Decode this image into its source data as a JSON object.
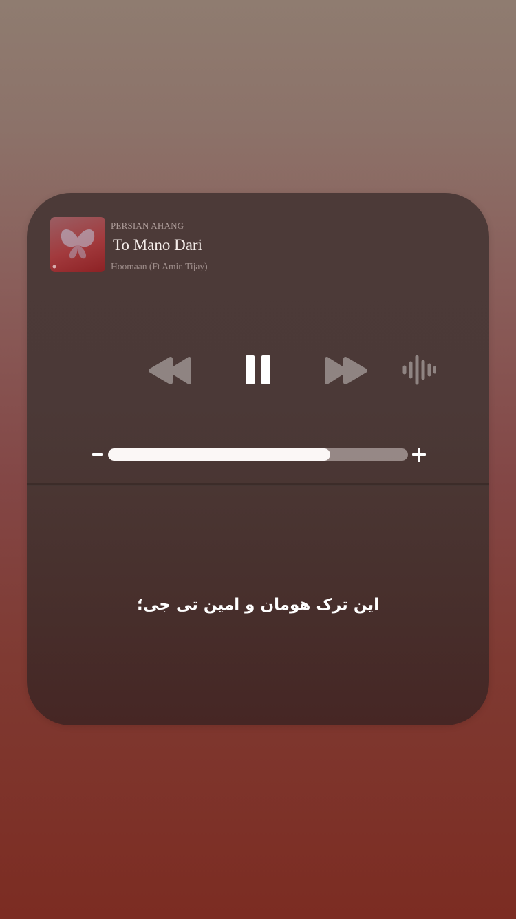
{
  "player": {
    "app_name": "PERSIAN AHANG",
    "title": "To Mano Dari",
    "artist": "Hoomaan (Ft Amin Tijay)",
    "controls": {
      "rewind_icon": "rewind-icon",
      "pause_icon": "pause-icon",
      "forward_icon": "fast-forward-icon",
      "audio_output_icon": "waveform-icon"
    },
    "volume": {
      "minus_icon": "minus-icon",
      "plus_icon": "plus-icon",
      "level": 0.74
    }
  },
  "caption": "این ترک هومان و امین تی جی؛",
  "colors": {
    "card_background": "#4b3937",
    "volume_fill": "#fbf7f6",
    "icon_inactive": "#8f8482",
    "icon_active": "#ffffff"
  }
}
